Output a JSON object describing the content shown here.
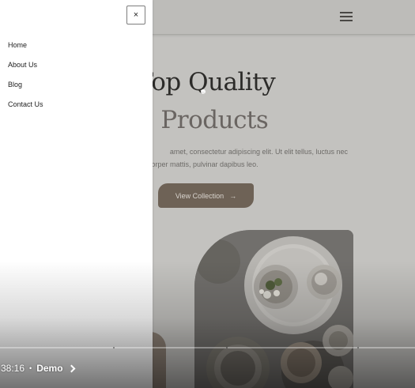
{
  "drawer": {
    "close_label": "×",
    "menu": [
      "Home",
      "About Us",
      "Blog",
      "Contact Us"
    ]
  },
  "header": {
    "menu_icon": "hamburger-menu-icon"
  },
  "hero": {
    "title_line1": "ake Top Quality",
    "title_line2": "made Products",
    "desc_line1": "amet, consectetur adipiscing elit. Ut elit tellus, luctus nec",
    "desc_line2": "corper mattis, pulvinar dapibus leo.",
    "cta_label": "View Collection",
    "cta_arrow": "→"
  },
  "player": {
    "time": "38:16",
    "separator": "•",
    "chapter": "Demo"
  },
  "colors": {
    "drawer_bg": "#ffffff",
    "overlay_page": "#c3c2bf",
    "cta_bg": "#6e6256",
    "title_dark": "#2c2b29"
  }
}
